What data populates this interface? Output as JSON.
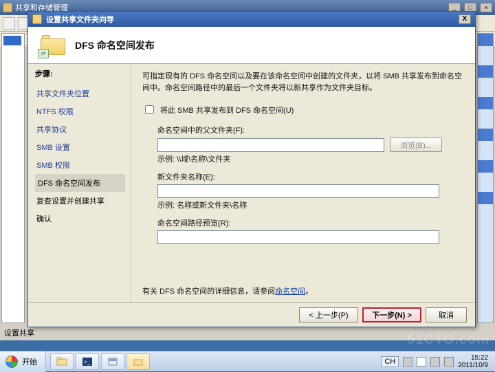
{
  "bgwin": {
    "title": "共享和存储管理",
    "bottom_label": "设置共享"
  },
  "dialog": {
    "title": "设置共享文件夹向导",
    "heading": "DFS 命名空间发布",
    "close_x": "X"
  },
  "steps": {
    "title": "步骤:",
    "items": [
      "共享文件夹位置",
      "NTFS 权限",
      "共享协议",
      "SMB 设置",
      "SMB 权限",
      "DFS 命名空间发布",
      "复查设置并创建共享",
      "确认"
    ]
  },
  "content": {
    "intro": "可指定现有的 DFS 命名空间以及要在该命名空间中创建的文件夹，以将 SMB 共享发布到命名空间中。命名空间路径中的最后一个文件夹将以新共享作为文件夹目标。",
    "publish_checkbox": "将此 SMB 共享发布到 DFS 命名空间(U)",
    "parent_label": "命名空间中的父文件夹(F):",
    "parent_value": "",
    "browse_btn": "浏览(B)...",
    "example1": "示例: \\\\域\\名称\\文件夹",
    "newfolder_label": "新文件夹名称(E):",
    "newfolder_value": "",
    "example2": "示例: 名称或新文件夹\\名称",
    "preview_label": "命名空间路径预览(R):",
    "preview_value": "",
    "moreinfo_prefix": "有关 DFS 命名空间的详细信息，请参阅",
    "moreinfo_link": "命名空间",
    "moreinfo_suffix": "。"
  },
  "footer": {
    "prev": "< 上一步(P)",
    "next": "下一步(N) >",
    "cancel": "取消"
  },
  "taskbar": {
    "start": "开始",
    "lang": "CH",
    "time": "15:22",
    "date": "2011/10/9"
  },
  "watermark": "51CTO.com"
}
